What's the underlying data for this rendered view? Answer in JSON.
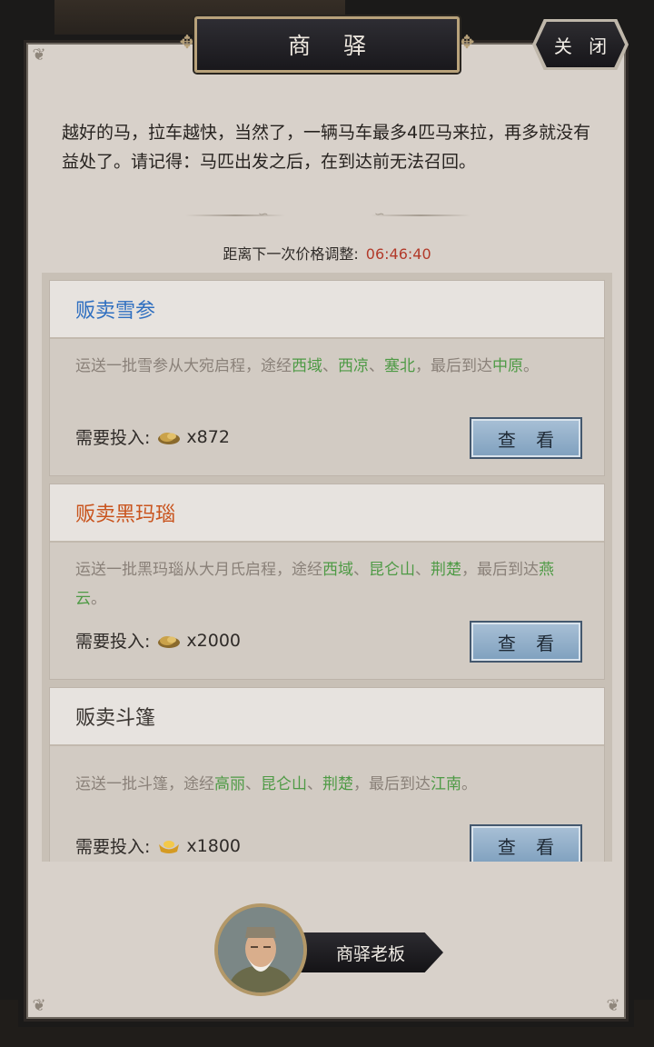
{
  "title": "商 驿",
  "close_label": "关 闭",
  "description": "越好的马，拉车越快，当然了，一辆马车最多4匹马来拉，再多就没有益处了。请记得：马匹出发之后，在到达前无法召回。",
  "countdown": {
    "label": "距离下一次价格调整:",
    "time": "06:46:40"
  },
  "cost_label": "需要投入:",
  "view_label": "查 看",
  "cards": [
    {
      "title": "贩卖雪参",
      "title_color": "#2f6fc0",
      "route": [
        {
          "t": "运送一批雪参从大宛启程，途经",
          "c": "n"
        },
        {
          "t": "西域",
          "c": "g"
        },
        {
          "t": "、",
          "c": "n"
        },
        {
          "t": "西凉",
          "c": "g"
        },
        {
          "t": "、",
          "c": "n"
        },
        {
          "t": "塞北",
          "c": "g"
        },
        {
          "t": "，最后到达",
          "c": "n"
        },
        {
          "t": "中原",
          "c": "g"
        },
        {
          "t": "。",
          "c": "n"
        }
      ],
      "currency_icon": "gold-nugget-icon",
      "cost": "x872"
    },
    {
      "title": "贩卖黑玛瑙",
      "title_color": "#c9541e",
      "route": [
        {
          "t": "运送一批黑玛瑙从大月氏启程，途经",
          "c": "n"
        },
        {
          "t": "西域",
          "c": "g"
        },
        {
          "t": "、",
          "c": "n"
        },
        {
          "t": "昆仑山",
          "c": "g"
        },
        {
          "t": "、",
          "c": "n"
        },
        {
          "t": "荆楚",
          "c": "g"
        },
        {
          "t": "，最后到达",
          "c": "n"
        },
        {
          "t": "燕云",
          "c": "g"
        },
        {
          "t": "。",
          "c": "n"
        }
      ],
      "currency_icon": "gold-nugget-icon",
      "cost": "x2000"
    },
    {
      "title": "贩卖斗篷",
      "title_color": "#3a3531",
      "route": [
        {
          "t": "运送一批斗篷，途经",
          "c": "n"
        },
        {
          "t": "高丽",
          "c": "g"
        },
        {
          "t": "、",
          "c": "n"
        },
        {
          "t": "昆仑山",
          "c": "g"
        },
        {
          "t": "、",
          "c": "n"
        },
        {
          "t": "荆楚",
          "c": "g"
        },
        {
          "t": "，最后到达",
          "c": "n"
        },
        {
          "t": "江南",
          "c": "g"
        },
        {
          "t": "。",
          "c": "n"
        }
      ],
      "currency_icon": "gold-ingot-icon",
      "cost": "x1800"
    }
  ],
  "npc_name": "商驿老板"
}
